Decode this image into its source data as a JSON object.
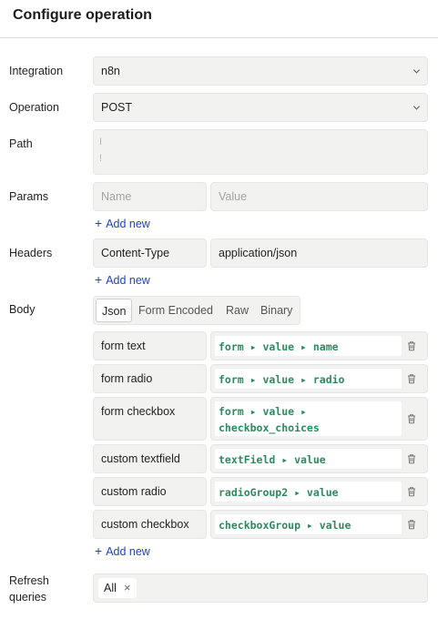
{
  "header": {
    "title": "Configure operation"
  },
  "integration": {
    "label": "Integration",
    "value": "n8n"
  },
  "operation": {
    "label": "Operation",
    "value": "POST"
  },
  "path": {
    "label": "Path",
    "line1": "I",
    "line2": "!"
  },
  "params": {
    "label": "Params",
    "name_placeholder": "Name",
    "value_placeholder": "Value",
    "add_new": "Add new"
  },
  "headers": {
    "label": "Headers",
    "key": "Content-Type",
    "value": "application/json",
    "add_new": "Add new"
  },
  "body": {
    "label": "Body",
    "tabs": [
      "Json",
      "Form Encoded",
      "Raw",
      "Binary"
    ],
    "active_tab": "Json",
    "rows": [
      {
        "key": "form text",
        "value": "form ▸ value ▸ name"
      },
      {
        "key": "form radio",
        "value": "form ▸ value ▸ radio"
      },
      {
        "key": "form checkbox",
        "value_line1": "form ▸ value ▸",
        "value_line2": "checkbox_choices"
      },
      {
        "key": "custom textfield",
        "value": "textField ▸ value"
      },
      {
        "key": "custom radio",
        "value": "radioGroup2 ▸ value"
      },
      {
        "key": "custom checkbox",
        "value": "checkboxGroup ▸ value"
      }
    ],
    "add_new": "Add new"
  },
  "refresh": {
    "label_line1": "Refresh",
    "label_line2": "queries",
    "chip": "All",
    "chip_remove": "×"
  },
  "icons": {
    "add": "plus-icon",
    "delete": "trash-icon",
    "dropdown": "chevron-down-icon",
    "remove": "close-icon"
  },
  "colors": {
    "link": "#1f3fd6",
    "code": "#2b8a5e",
    "field_bg": "#f2f2f1"
  }
}
